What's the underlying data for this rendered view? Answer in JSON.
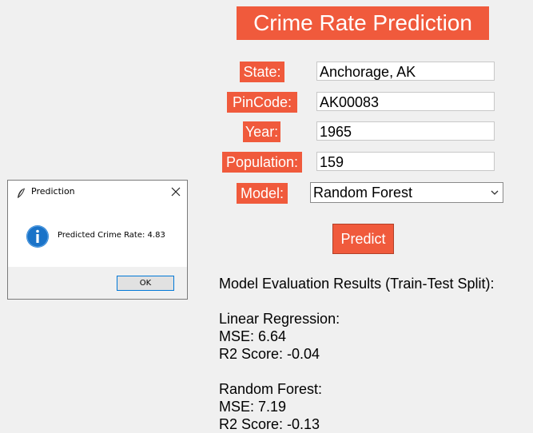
{
  "app": {
    "title": "Crime Rate Prediction"
  },
  "form": {
    "state_label": "State:",
    "state_value": "Anchorage, AK",
    "pincode_label": "PinCode:",
    "pincode_value": "AK00083",
    "year_label": "Year:",
    "year_value": "1965",
    "population_label": "Population:",
    "population_value": "159",
    "model_label": "Model:",
    "model_selected": "Random Forest"
  },
  "predict_button": "Predict",
  "results": {
    "heading": "Model Evaluation Results (Train-Test Split):",
    "lr_title": "Linear Regression:",
    "lr_mse": "MSE: 6.64",
    "lr_r2": "R2 Score: -0.04",
    "rf_title": "Random Forest:",
    "rf_mse": "MSE: 7.19",
    "rf_r2": "R2 Score: -0.13"
  },
  "dialog": {
    "title": "Prediction",
    "message": "Predicted Crime Rate: 4.83",
    "ok_label": "OK"
  },
  "colors": {
    "accent": "#f05a3c",
    "info_icon": "#1a73c8",
    "window_bg": "#f0f0f0"
  },
  "icons": {
    "dropdown": "chevron-down-icon",
    "dialog_app": "feather-icon",
    "dialog_close": "close-icon",
    "dialog_info": "info-icon"
  }
}
